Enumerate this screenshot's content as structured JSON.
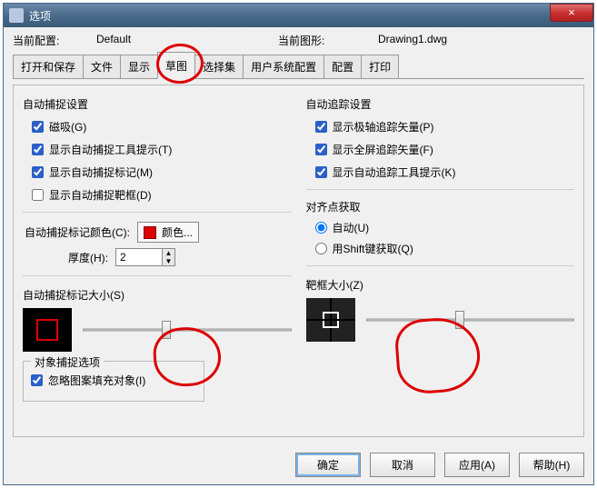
{
  "titlebar": {
    "title": "选项",
    "close_glyph": "×"
  },
  "header": {
    "current_profile_label": "当前配置:",
    "current_profile_value": "Default",
    "current_drawing_label": "当前图形:",
    "current_drawing_value": "Drawing1.dwg"
  },
  "tabs": {
    "items": [
      {
        "label": "打开和保存"
      },
      {
        "label": "文件"
      },
      {
        "label": "显示"
      },
      {
        "label": "草图"
      },
      {
        "label": "选择集"
      },
      {
        "label": "用户系统配置"
      },
      {
        "label": "配置"
      },
      {
        "label": "打印"
      }
    ],
    "active_index": 3
  },
  "left": {
    "autosnap_title": "自动捕捉设置",
    "chk_magnet": "磁吸(G)",
    "chk_magnet_checked": true,
    "chk_tooltip": "显示自动捕捉工具提示(T)",
    "chk_tooltip_checked": true,
    "chk_marker": "显示自动捕捉标记(M)",
    "chk_marker_checked": true,
    "chk_aperture": "显示自动捕捉靶框(D)",
    "chk_aperture_checked": false,
    "marker_color_label": "自动捕捉标记颜色(C):",
    "color_button": "颜色...",
    "thickness_label": "厚度(H):",
    "thickness_value": "2",
    "marker_size_label": "自动捕捉标记大小(S)",
    "obj_group_title": "对象捕捉选项",
    "chk_ignore_hatch": "忽略图案填充对象(I)",
    "chk_ignore_hatch_checked": true
  },
  "right": {
    "autotrace_title": "自动追踪设置",
    "chk_polar_vector": "显示极轴追踪矢量(P)",
    "chk_polar_vector_checked": true,
    "chk_fullscreen_vector": "显示全屏追踪矢量(F)",
    "chk_fullscreen_vector_checked": true,
    "chk_trace_tooltip": "显示自动追踪工具提示(K)",
    "chk_trace_tooltip_checked": true,
    "align_title": "对齐点获取",
    "radio_auto": "自动(U)",
    "radio_shift": "用Shift键获取(Q)",
    "aperture_size_label": "靶框大小(Z)"
  },
  "buttons": {
    "ok": "确定",
    "cancel": "取消",
    "apply": "应用(A)",
    "help": "帮助(H)"
  }
}
